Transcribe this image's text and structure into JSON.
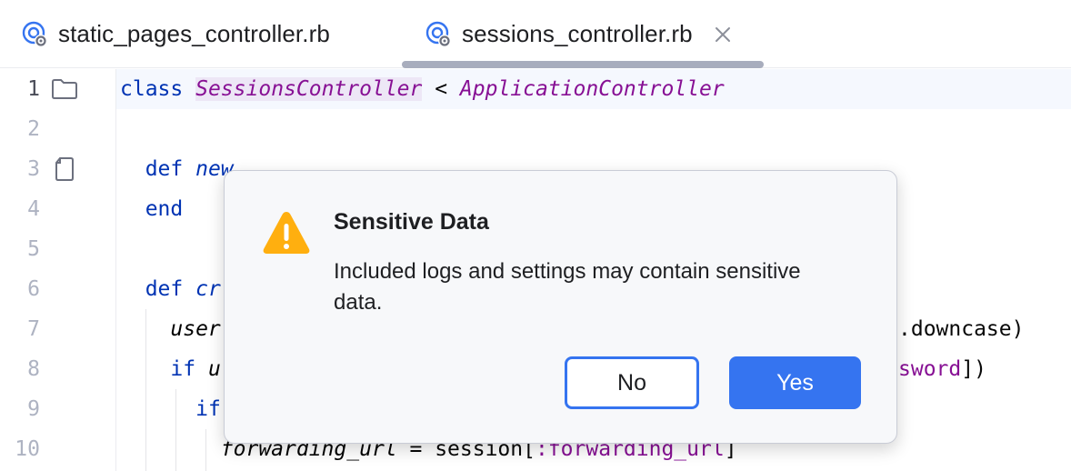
{
  "tabs": [
    {
      "label": "static_pages_controller.rb",
      "icon": "ruby-controller-icon",
      "active": false
    },
    {
      "label": "sessions_controller.rb",
      "icon": "ruby-controller-icon",
      "active": true,
      "close": "✕"
    }
  ],
  "editor": {
    "line_numbers": [
      "1",
      "2",
      "3",
      "4",
      "5",
      "6",
      "7",
      "8",
      "9",
      "10"
    ],
    "lines": {
      "l1": {
        "kw": "class",
        "cls": "SessionsController",
        "op": " < ",
        "parent": "ApplicationController"
      },
      "l3": {
        "kw": "def",
        "name": "new"
      },
      "l4": {
        "kw": "end"
      },
      "l6": {
        "kw": "def",
        "name": "cr"
      },
      "l7": {
        "var": "user",
        "tail": ".downcase)"
      },
      "l8": {
        "kw": "if",
        "rest": " u",
        "sym": "sword",
        "tail": "])"
      },
      "l9": {
        "kw": "if"
      },
      "l10": {
        "var": "forwarding_url",
        "op": " = session[",
        "sym": ":forwarding_url",
        "tail": "]"
      }
    }
  },
  "dialog": {
    "title": "Sensitive Data",
    "message": "Included logs and settings may contain sensitive data.",
    "no_label": "No",
    "yes_label": "Yes",
    "icon": "warning-icon"
  },
  "colors": {
    "accent": "#3574f0",
    "warning": "#ffaf0f",
    "keyword": "#0033b3",
    "class": "#871094"
  }
}
